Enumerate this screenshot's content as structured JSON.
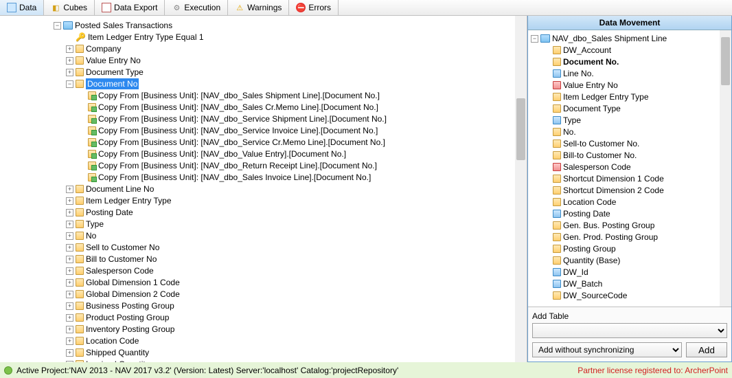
{
  "tabs": {
    "data": "Data",
    "cubes": "Cubes",
    "export": "Data Export",
    "exec": "Execution",
    "warn": "Warnings",
    "err": "Errors"
  },
  "tree": {
    "root": "Posted Sales Transactions",
    "key": "Item Ledger Entry Type Equal 1",
    "cols": [
      "Company",
      "Value Entry No",
      "Document Type",
      "Document No",
      "Document Line No",
      "Item Ledger Entry Type",
      "Posting Date",
      "Type",
      "No",
      "Sell to Customer No",
      "Bill to Customer No",
      "Salesperson Code",
      "Global Dimension 1 Code",
      "Global Dimension 2 Code",
      "Business Posting Group",
      "Product Posting Group",
      "Inventory Posting Group",
      "Location Code",
      "Shipped Quantity",
      "Invoiced Quantity"
    ],
    "copies": [
      "Copy From [Business Unit]: [NAV_dbo_Sales Shipment Line].[Document No.]",
      "Copy From [Business Unit]: [NAV_dbo_Sales Cr.Memo Line].[Document No.]",
      "Copy From [Business Unit]: [NAV_dbo_Service Shipment Line].[Document No.]",
      "Copy From [Business Unit]: [NAV_dbo_Service Invoice Line].[Document No.]",
      "Copy From [Business Unit]: [NAV_dbo_Service Cr.Memo Line].[Document No.]",
      "Copy From [Business Unit]: [NAV_dbo_Value Entry].[Document No.]",
      "Copy From [Business Unit]: [NAV_dbo_Return Receipt Line].[Document No.]",
      "Copy From [Business Unit]: [NAV_dbo_Sales Invoice Line].[Document No.]"
    ]
  },
  "right": {
    "title": "Data Movement",
    "root": "NAV_dbo_Sales Shipment Line",
    "items": [
      {
        "t": "DW_Account",
        "s": "col"
      },
      {
        "t": "Document No.",
        "s": "col",
        "b": true
      },
      {
        "t": "Line No.",
        "s": "blue"
      },
      {
        "t": "Value Entry No",
        "s": "red"
      },
      {
        "t": "Item Ledger Entry Type",
        "s": "col"
      },
      {
        "t": "Document Type",
        "s": "col"
      },
      {
        "t": "Type",
        "s": "blue"
      },
      {
        "t": "No.",
        "s": "col"
      },
      {
        "t": "Sell-to Customer No.",
        "s": "col"
      },
      {
        "t": "Bill-to Customer No.",
        "s": "col"
      },
      {
        "t": "Salesperson Code",
        "s": "red"
      },
      {
        "t": "Shortcut Dimension 1 Code",
        "s": "col"
      },
      {
        "t": "Shortcut Dimension 2 Code",
        "s": "col"
      },
      {
        "t": "Location Code",
        "s": "col"
      },
      {
        "t": "Posting Date",
        "s": "blue"
      },
      {
        "t": "Gen. Bus. Posting Group",
        "s": "col"
      },
      {
        "t": "Gen. Prod. Posting Group",
        "s": "col"
      },
      {
        "t": "Posting Group",
        "s": "col"
      },
      {
        "t": "Quantity (Base)",
        "s": "col"
      },
      {
        "t": "DW_Id",
        "s": "blue"
      },
      {
        "t": "DW_Batch",
        "s": "blue"
      },
      {
        "t": "DW_SourceCode",
        "s": "col"
      }
    ],
    "addLabel": "Add Table",
    "addMode": "Add without synchronizing",
    "addBtn": "Add"
  },
  "status": {
    "left": "Active Project:'NAV 2013 - NAV 2017 v3.2' (Version: Latest) Server:'localhost' Catalog:'projectRepository'",
    "right": "Partner license registered to: ArcherPoint"
  }
}
